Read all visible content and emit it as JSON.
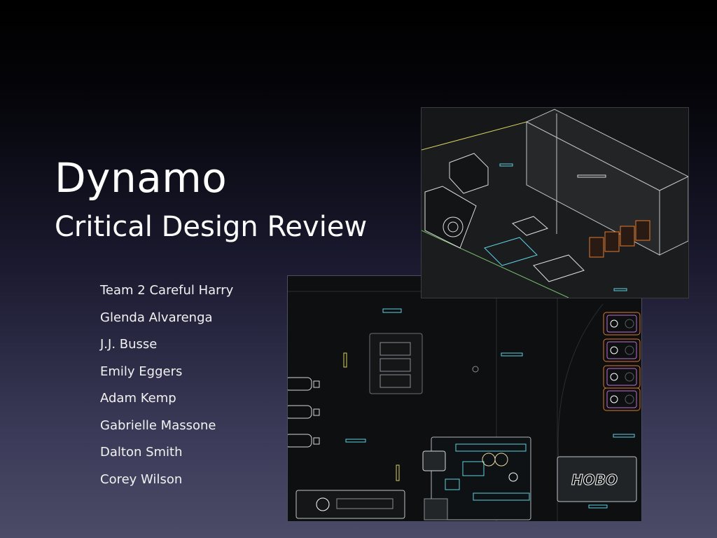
{
  "slide": {
    "title": "Dynamo",
    "subtitle": "Critical Design Review",
    "team_members": [
      "Team 2 Careful Harry",
      "Glenda Alvarenga",
      "J.J. Busse",
      "Emily Eggers",
      "Adam Kemp",
      "Gabrielle Massone",
      "Dalton Smith",
      "Corey Wilson"
    ]
  },
  "board_image": {
    "logger_label": "HOBO"
  },
  "colors": {
    "background_top": "#000000",
    "background_bottom": "#4b4b68",
    "text": "#ffffff",
    "outline_cyan": "#5fd0e0",
    "outline_magenta": "#c070d0",
    "outline_orange": "#e07a30",
    "outline_yellow": "#d8d060"
  }
}
